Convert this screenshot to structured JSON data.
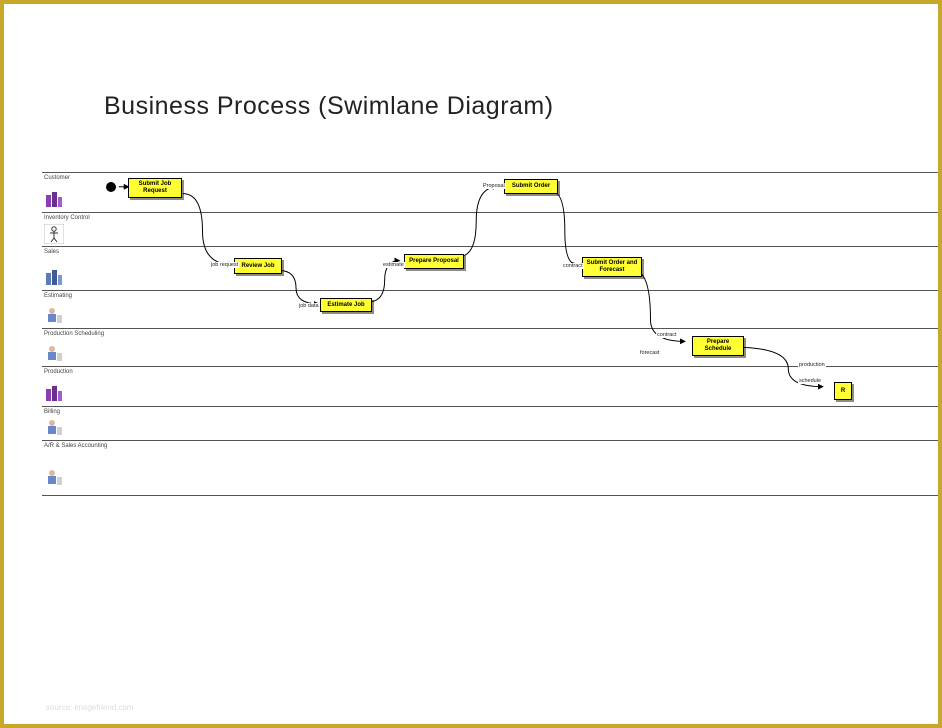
{
  "title": "Business Process (Swimlane Diagram)",
  "lanes": [
    {
      "name": "Customer"
    },
    {
      "name": "Inventory Control"
    },
    {
      "name": "Sales"
    },
    {
      "name": "Estimating"
    },
    {
      "name": "Production Scheduling"
    },
    {
      "name": "Production"
    },
    {
      "name": "Billing"
    },
    {
      "name": "A/R & Sales Accounting"
    }
  ],
  "nodes": {
    "submit_job_request": "Submit Job Request",
    "submit_order": "Submit Order",
    "review_job": "Review Job",
    "prepare_proposal": "Prepare Proposal",
    "submit_order_forecast": "Submit Order and Forecast",
    "estimate_job": "Estimate Job",
    "prepare_schedule": "Prepare Schedule",
    "partial_r": "R"
  },
  "edge_labels": {
    "job_request": "job request",
    "estimate": "estimate",
    "proposal": "Proposal",
    "contract": "contract",
    "job_data": "job data",
    "contract2": "contract",
    "forecast": "forecast",
    "production": "production",
    "schedule": "schedule"
  },
  "footer": "source: imagefriend.com"
}
